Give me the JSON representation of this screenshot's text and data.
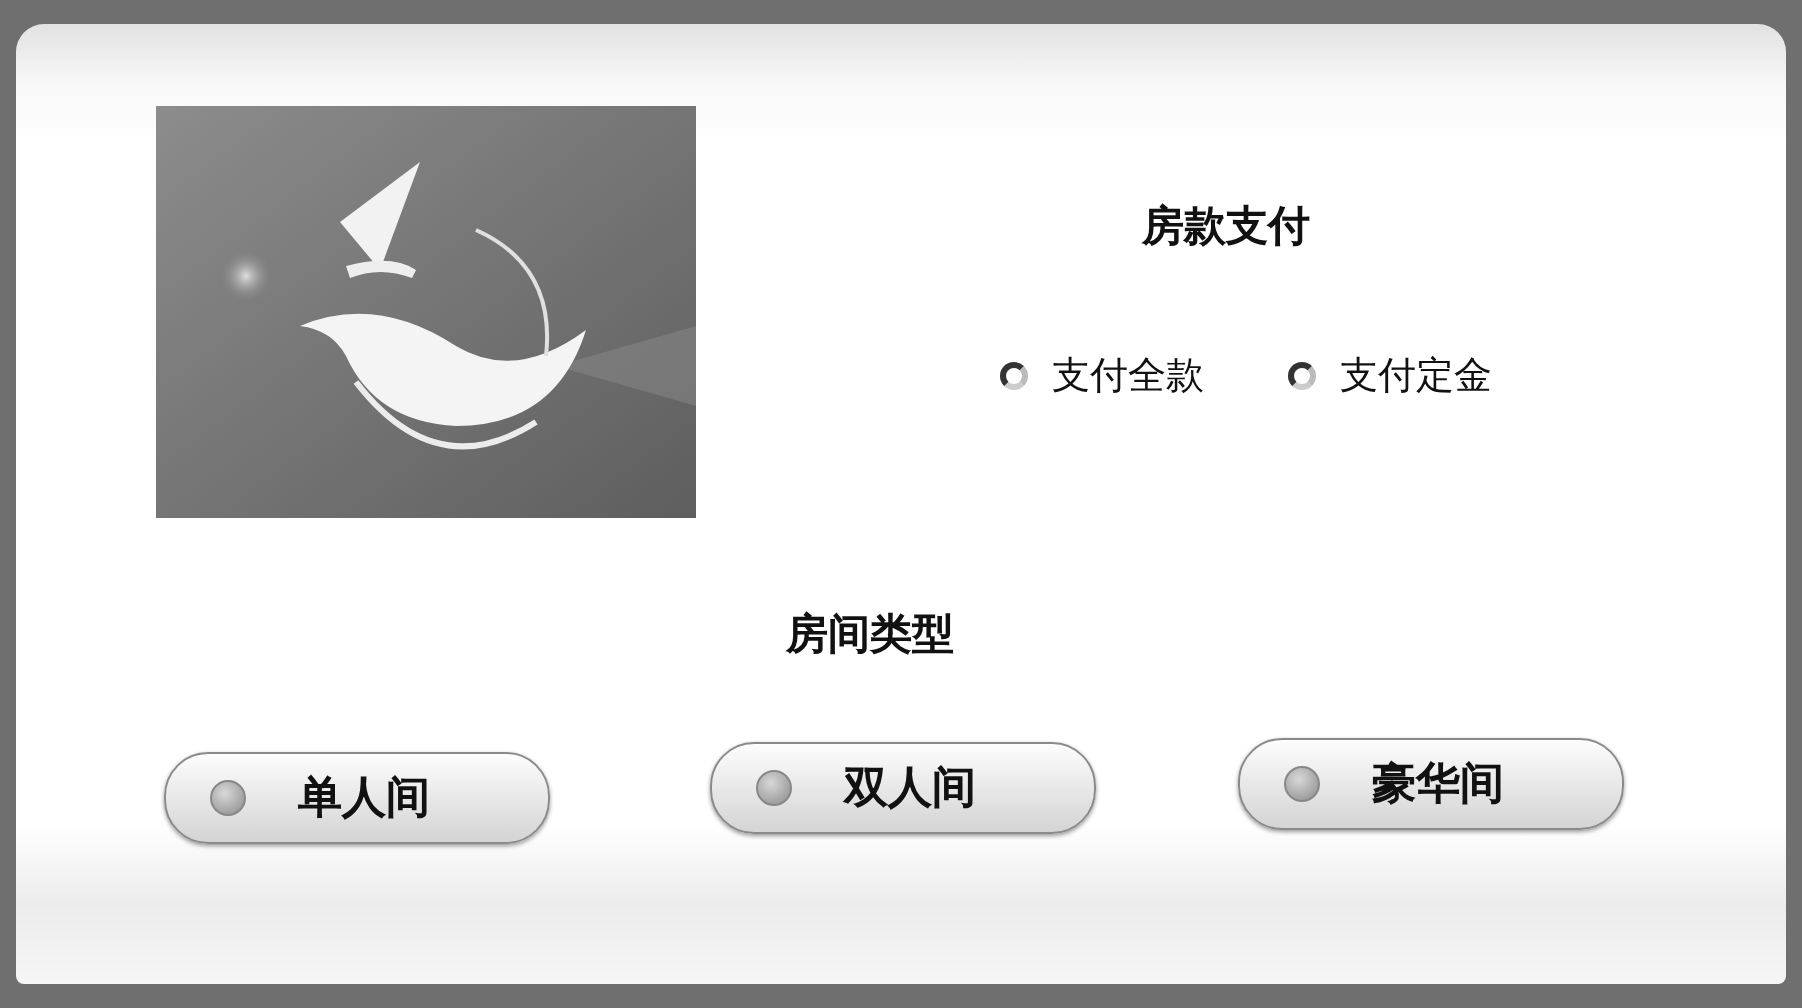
{
  "payment": {
    "title": "房款支付",
    "options": [
      {
        "label": "支付全款",
        "selected": false
      },
      {
        "label": "支付定金",
        "selected": false
      }
    ]
  },
  "room_type": {
    "title": "房间类型",
    "options": [
      {
        "label": "单人间",
        "selected": false
      },
      {
        "label": "双人间",
        "selected": false
      },
      {
        "label": "豪华间",
        "selected": false
      }
    ]
  }
}
